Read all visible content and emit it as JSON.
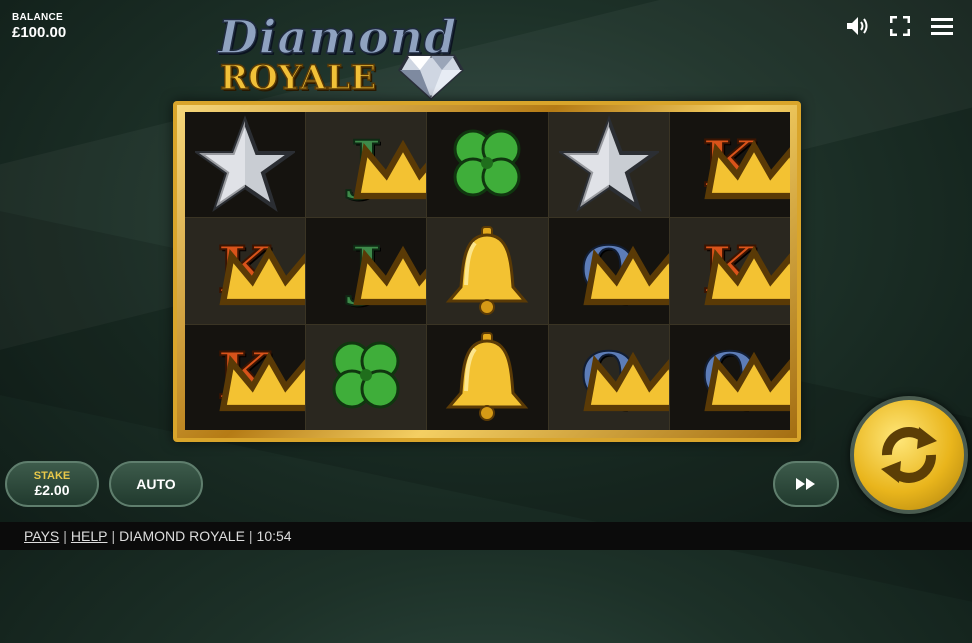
{
  "balance": {
    "label": "BALANCE",
    "value": "£100.00"
  },
  "logo": {
    "line1": "Diamond",
    "line2": "ROYALE"
  },
  "controls": {
    "sound": "speaker-icon",
    "fullscreen": "fullscreen-icon",
    "menu": "hamburger-menu-icon"
  },
  "reels": [
    [
      "star",
      "J",
      "clover",
      "star",
      "K"
    ],
    [
      "K",
      "J",
      "bell",
      "Q",
      "K"
    ],
    [
      "K",
      "clover",
      "bell",
      "Q",
      "Q"
    ]
  ],
  "stake": {
    "label": "STAKE",
    "value": "£2.00"
  },
  "auto": {
    "label": "AUTO"
  },
  "footer": {
    "pays": "PAYS",
    "help": "HELP",
    "game_name": "DIAMOND ROYALE",
    "time": "10:54"
  },
  "colors": {
    "gold": "#e9b51c",
    "button": "#2c4a3b",
    "bg": "#1d3128"
  }
}
